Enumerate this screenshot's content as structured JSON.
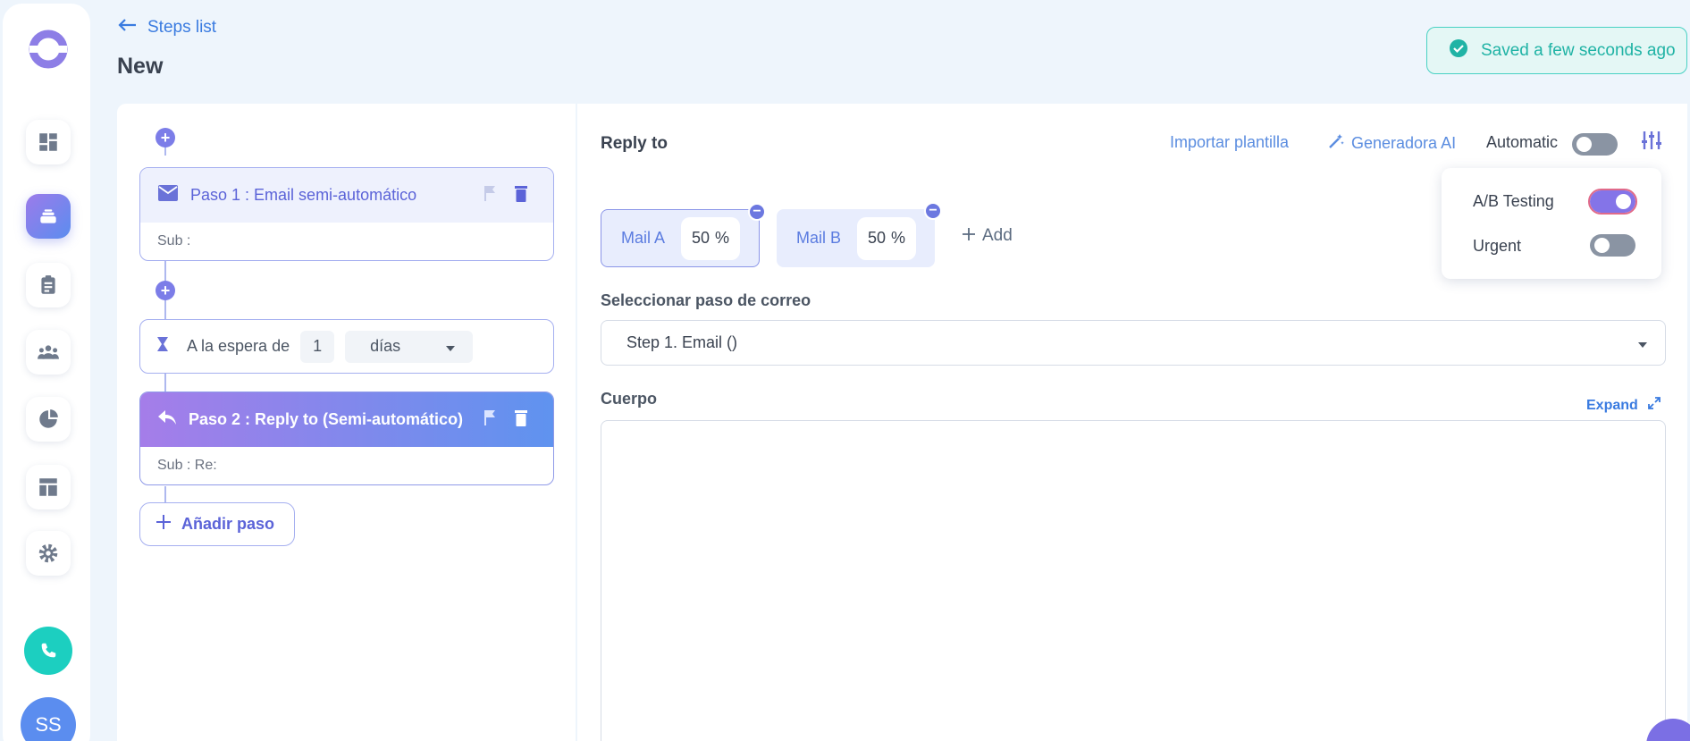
{
  "header": {
    "back_label": "Steps list",
    "title": "New",
    "saved_status": "Saved a few seconds ago"
  },
  "sidebar": {
    "items": [
      {
        "name": "dashboard-icon"
      },
      {
        "name": "sequences-icon",
        "active": true
      },
      {
        "name": "tasks-icon"
      },
      {
        "name": "contacts-icon"
      },
      {
        "name": "reports-icon"
      },
      {
        "name": "templates-icon"
      },
      {
        "name": "settings-icon"
      }
    ],
    "avatar_initials": "SS"
  },
  "steps": [
    {
      "title": "Paso 1 : Email semi-automático",
      "subject": "Sub :"
    },
    {
      "title": "Paso 2 : Reply to (Semi-automático)",
      "subject": "Sub : Re:"
    }
  ],
  "wait": {
    "label": "A la espera de",
    "value": "1",
    "unit": "días"
  },
  "add_step_label": "Añadir paso",
  "editor": {
    "title": "Reply to",
    "import_label": "Importar plantilla",
    "generator_label": "Generadora AI",
    "automatic_label": "Automatic",
    "automatic_on": false,
    "mails": [
      {
        "label": "Mail A",
        "percent": "50",
        "unit": "%"
      },
      {
        "label": "Mail B",
        "percent": "50",
        "unit": "%"
      }
    ],
    "add_mail_label": "Add",
    "select_step_label": "Seleccionar paso de correo",
    "select_step_value": "Step 1. Email ()",
    "body_label": "Cuerpo",
    "expand_label": "Expand"
  },
  "options_panel": {
    "ab_testing_label": "A/B Testing",
    "ab_testing_on": true,
    "urgent_label": "Urgent",
    "urgent_on": false
  },
  "colors": {
    "accent": "#7c7de8",
    "link": "#3a7be0",
    "success": "#20b3a5",
    "phone": "#1ccfc0"
  }
}
